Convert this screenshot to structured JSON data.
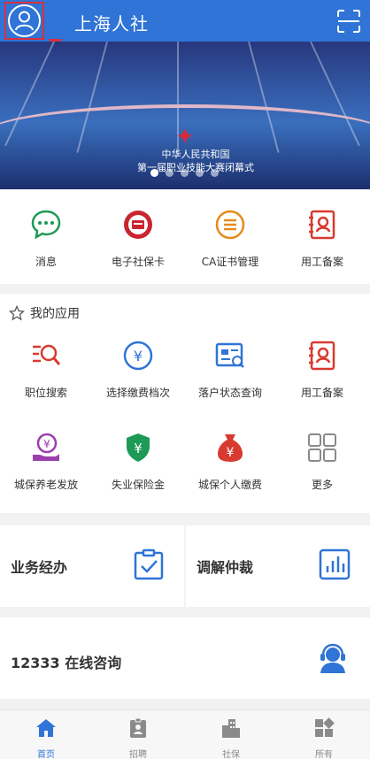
{
  "header": {
    "title": "上海人社",
    "avatar_icon": "user-icon",
    "scan_icon": "scan-icon",
    "accent_color": "#2f74d6",
    "highlight_color": "#d8303c"
  },
  "banner": {
    "caption_line1": "中华人民共和国",
    "caption_line2": "第一届职业技能大赛闭幕式",
    "slide_count": 5,
    "active_slide": 1
  },
  "quick_actions": [
    {
      "label": "消息",
      "icon": "chat-bubble-icon"
    },
    {
      "label": "电子社保卡",
      "icon": "social-security-card-icon"
    },
    {
      "label": "CA证书管理",
      "icon": "certificate-icon"
    },
    {
      "label": "用工备案",
      "icon": "employment-record-icon"
    }
  ],
  "my_apps": {
    "title": "我的应用",
    "title_icon": "star-outline-icon",
    "items": [
      {
        "label": "职位搜索",
        "icon": "job-search-icon"
      },
      {
        "label": "选择缴费档次",
        "icon": "yuan-circle-icon"
      },
      {
        "label": "落户状态查询",
        "icon": "id-card-search-icon"
      },
      {
        "label": "用工备案",
        "icon": "employment-record-icon"
      },
      {
        "label": "城保养老发放",
        "icon": "pension-hand-icon"
      },
      {
        "label": "失业保险金",
        "icon": "shield-yuan-icon"
      },
      {
        "label": "城保个人缴费",
        "icon": "money-bag-icon"
      },
      {
        "label": "更多",
        "icon": "more-grid-icon"
      }
    ]
  },
  "services": [
    {
      "label": "业务经办",
      "icon": "clipboard-check-icon"
    },
    {
      "label": "调解仲裁",
      "icon": "bar-chart-icon"
    }
  ],
  "consult": {
    "label": "12333 在线咨询",
    "icon": "headset-agent-icon"
  },
  "tabbar": [
    {
      "label": "首页",
      "icon": "home-icon",
      "active": true
    },
    {
      "label": "招聘",
      "icon": "badge-icon",
      "active": false
    },
    {
      "label": "社保",
      "icon": "buildings-icon",
      "active": false
    },
    {
      "label": "所有",
      "icon": "all-apps-icon",
      "active": false
    }
  ]
}
